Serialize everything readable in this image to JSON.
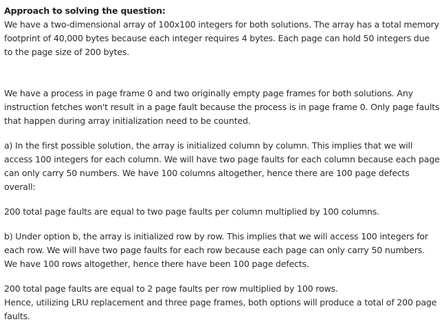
{
  "document": {
    "heading": "Approach to solving the question:",
    "paragraphs": [
      "We have a two-dimensional array of 100x100 integers for both solutions. The array has a total memory footprint of 40,000 bytes because each integer requires 4 bytes. Each page can hold 50 integers due to the page size of 200 bytes.",
      "We have a process in page frame 0 and two originally empty page frames for both solutions. Any instruction fetches won't result in a page fault because the process is in page frame 0. Only page faults that happen during array initialization need to be counted.",
      "a) In the first possible solution, the array is initialized column by column. This implies that we will access 100 integers for each column. We will have two page faults for each column because each page can only carry 50 numbers. We have 100 columns altogether, hence there are 100 page defects overall:",
      "200 total page faults are equal to two page faults per column multiplied by 100 columns.",
      "b) Under option b, the array is initialized row by row. This implies that we will access 100 integers for each row. We will have two page faults for each row because each page can only carry 50 numbers. We have 100 rows altogether, hence there have been 100 page defects.",
      "200 total page faults are equal to 2 page faults per row multiplied by 100 rows.",
      "Hence, utilizing LRU replacement and three page frames, both options will produce a total of 200 page faults."
    ]
  }
}
